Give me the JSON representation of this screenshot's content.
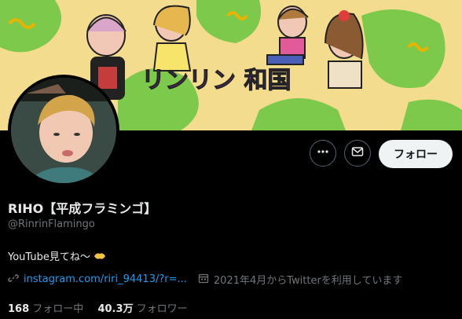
{
  "banner": {
    "title_art": "リンリン 和国"
  },
  "profile": {
    "name": "RIHO【平成フラミンゴ】",
    "handle": "@RinrinFlamingo",
    "bio": "YouTube見てね〜",
    "link": "instagram.com/riri_94413/?r=...",
    "joined": "2021年4月からTwitterを利用しています"
  },
  "stats": {
    "following_count": "168",
    "following_label": "フォロー中",
    "followers_count": "40.3万",
    "followers_label": "フォロワー"
  },
  "actions": {
    "follow_label": "フォロー"
  },
  "icons": [
    "more-icon",
    "mail-icon",
    "link-icon",
    "calendar-icon",
    "handshake-emoji"
  ],
  "colors": {
    "accent": "#1d9bf0",
    "banner_bg": "#f4dc8e",
    "follow_bg": "#eff3f4"
  }
}
